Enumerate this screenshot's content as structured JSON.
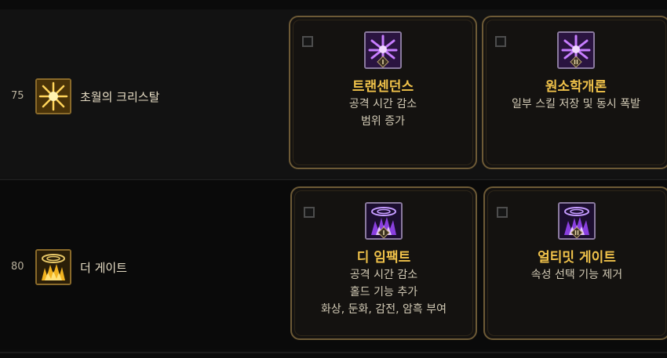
{
  "rows": [
    {
      "level": "75",
      "skill": {
        "name": "초월의 크리스탈",
        "icon": "crystal-burst-icon"
      },
      "options": [
        {
          "numeral": "I",
          "title": "트랜센던스",
          "desc": [
            "공격 시간 감소",
            "범위 증가"
          ],
          "icon": "crystal-shards-icon"
        },
        {
          "numeral": "II",
          "title": "원소학개론",
          "desc": [
            "일부 스킬 저장 및 동시 폭발"
          ],
          "icon": "crystal-shards-icon"
        }
      ]
    },
    {
      "level": "80",
      "skill": {
        "name": "더 게이트",
        "icon": "gate-flame-icon"
      },
      "options": [
        {
          "numeral": "I",
          "title": "디 임팩트",
          "desc": [
            "공격 시간 감소",
            "홀드 기능 추가",
            "화상, 둔화, 감전, 암흑 부여"
          ],
          "icon": "gate-portal-icon"
        },
        {
          "numeral": "II",
          "title": "얼티밋 게이트",
          "desc": [
            "속성 선택 기능 제거"
          ],
          "icon": "gate-portal-icon"
        }
      ]
    }
  ],
  "colors": {
    "title": "#f0c24a",
    "border": "#6d5a36",
    "skill_icon_border": "#8a6a2a",
    "option_icon_bg": "#2a1440"
  }
}
